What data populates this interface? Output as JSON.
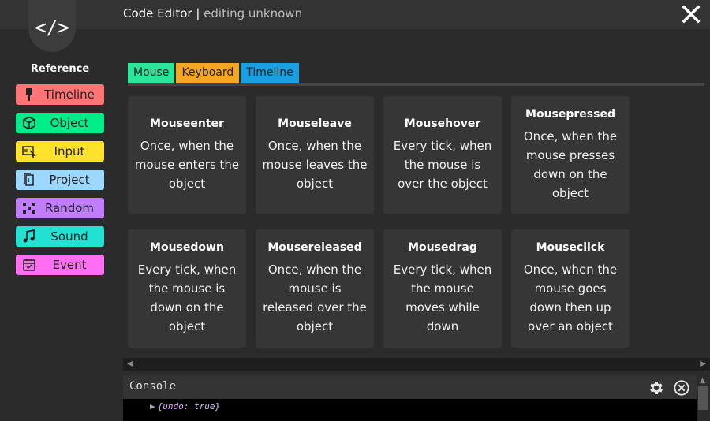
{
  "header": {
    "logo_text": "</>",
    "title": "Code Editor",
    "separator": " | ",
    "subtitle": "editing unknown"
  },
  "sidebar": {
    "heading": "Reference",
    "items": [
      {
        "label": "Timeline",
        "icon": "pin-icon",
        "color": "#ff7474"
      },
      {
        "label": "Object",
        "icon": "cube-icon",
        "color": "#00ee8a"
      },
      {
        "label": "Input",
        "icon": "input-icon",
        "color": "#ffe02a"
      },
      {
        "label": "Project",
        "icon": "files-icon",
        "color": "#9bd7ff"
      },
      {
        "label": "Random",
        "icon": "shuffle-icon",
        "color": "#c07dff"
      },
      {
        "label": "Sound",
        "icon": "music-note-icon",
        "color": "#22e0d2"
      },
      {
        "label": "Event",
        "icon": "calendar-icon",
        "color": "#ff6ef0"
      }
    ]
  },
  "tabs": [
    {
      "label": "Mouse",
      "color": "#2be59a"
    },
    {
      "label": "Keyboard",
      "color": "#f5a623"
    },
    {
      "label": "Timeline",
      "color": "#19a0e0"
    }
  ],
  "cards": [
    {
      "title": "Mouseenter",
      "desc": "Once, when the mouse enters the object"
    },
    {
      "title": "Mouseleave",
      "desc": "Once, when the mouse leaves the object"
    },
    {
      "title": "Mousehover",
      "desc": "Every tick, when the mouse is over the object"
    },
    {
      "title": "Mousepressed",
      "desc": "Once, when the mouse presses down on the object"
    },
    {
      "title": "Mousedown",
      "desc": "Every tick, when the mouse is down on the object"
    },
    {
      "title": "Mousereleased",
      "desc": "Once, when the mouse is released over the object"
    },
    {
      "title": "Mousedrag",
      "desc": "Every tick, when the mouse moves while down"
    },
    {
      "title": "Mouseclick",
      "desc": "Once, when the mouse goes down then up over an object"
    }
  ],
  "console": {
    "title": "Console",
    "log_open": "{",
    "log_key": "undo",
    "log_sep": ": ",
    "log_value": "true",
    "log_close": "}"
  }
}
